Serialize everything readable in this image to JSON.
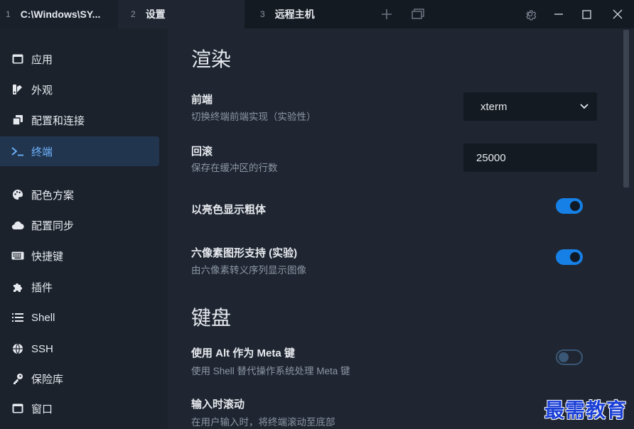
{
  "tabs": [
    {
      "num": "1",
      "title": "C:\\Windows\\SY..."
    },
    {
      "num": "2",
      "title": "设置"
    },
    {
      "num": "3",
      "title": "远程主机"
    }
  ],
  "sidebar": {
    "items": [
      {
        "label": "应用",
        "icon": "window-icon"
      },
      {
        "label": "外观",
        "icon": "palette-swatch-icon"
      },
      {
        "label": "配置和连接",
        "icon": "copy-icon"
      },
      {
        "label": "终端",
        "icon": "terminal-icon",
        "active": true
      },
      {
        "label": "配色方案",
        "icon": "palette-icon"
      },
      {
        "label": "配置同步",
        "icon": "cloud-icon"
      },
      {
        "label": "快捷键",
        "icon": "keyboard-icon"
      },
      {
        "label": "插件",
        "icon": "puzzle-icon"
      },
      {
        "label": "Shell",
        "icon": "list-icon"
      },
      {
        "label": "SSH",
        "icon": "globe-icon"
      },
      {
        "label": "保险库",
        "icon": "key-icon"
      },
      {
        "label": "窗口",
        "icon": "window-icon"
      }
    ]
  },
  "main": {
    "section_render": "渲染",
    "frontend": {
      "title": "前端",
      "desc": "切换终端前端实现（实验性）",
      "value": "xterm"
    },
    "scrollback": {
      "title": "回滚",
      "desc": "保存在缓冲区的行数",
      "value": "25000"
    },
    "bold_bright": {
      "title": "以亮色显示粗体",
      "on": true
    },
    "sixel": {
      "title": "六像素图形支持 (实验)",
      "desc": "由六像素转义序列显示图像",
      "on": true
    },
    "section_keyboard": "键盘",
    "alt_meta": {
      "title": "使用 Alt 作为 Meta 键",
      "desc": "使用 Shell 替代操作系统处理 Meta 键",
      "on": false
    },
    "scroll_on_input": {
      "title": "输入时滚动",
      "desc": "在用户输入时，将终端滚动至底部"
    }
  },
  "watermark": "最需教育",
  "colors": {
    "accent": "#1680e6",
    "active_text": "#6fb5ff",
    "bg": "#1f2631",
    "sidebar_bg": "#1b222c"
  }
}
